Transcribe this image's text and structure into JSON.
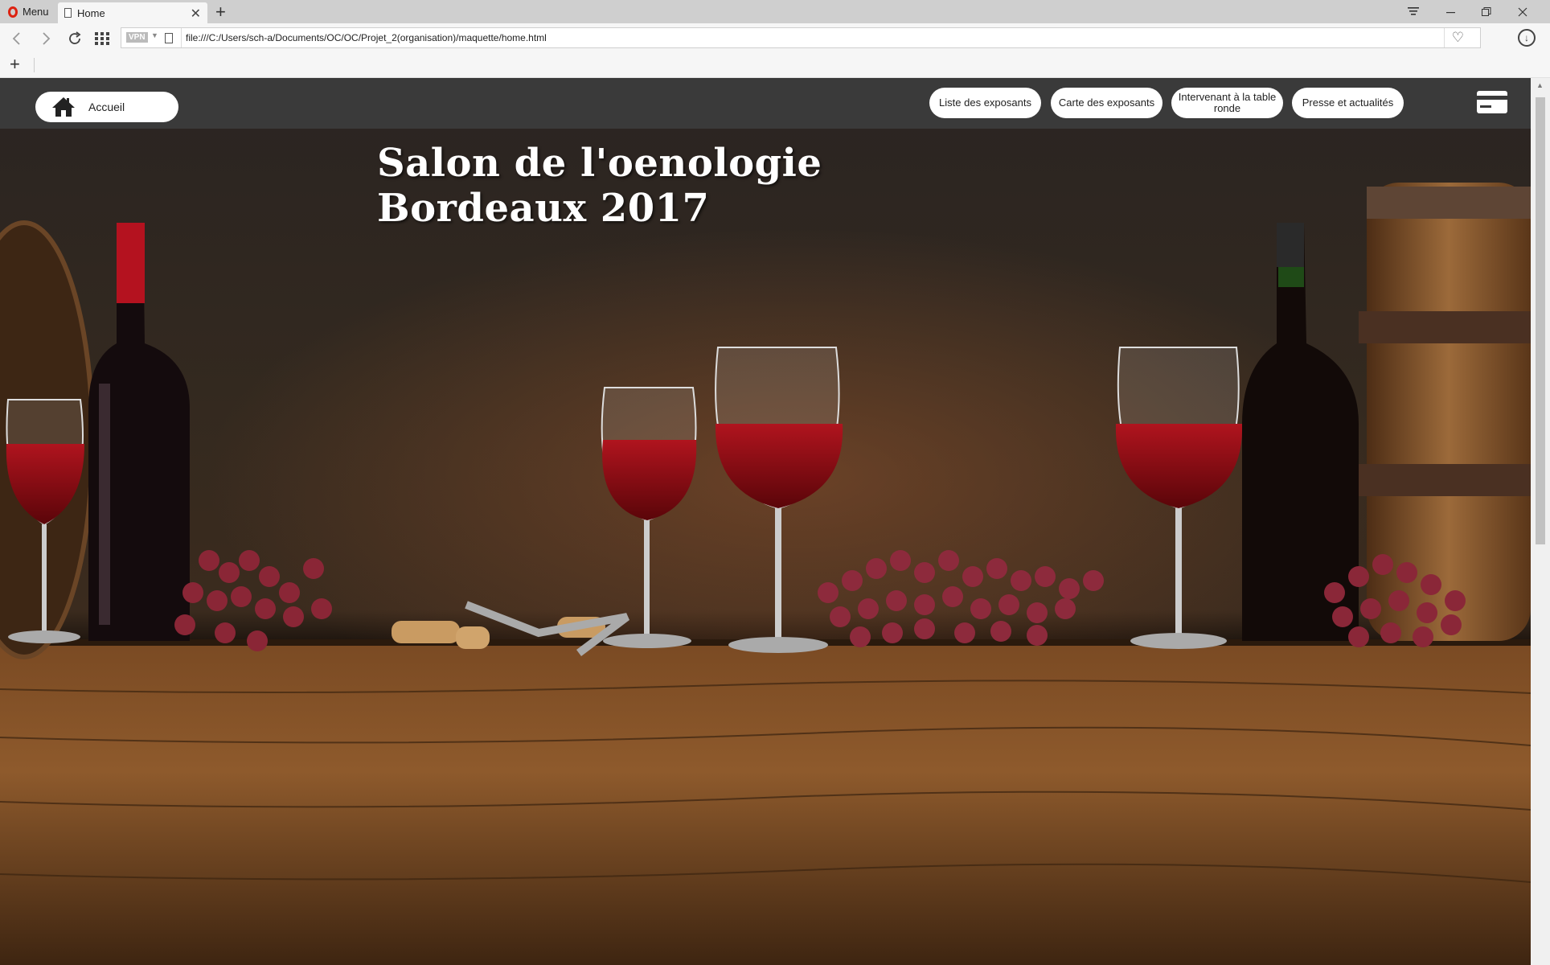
{
  "browser": {
    "menu_label": "Menu",
    "tab_title": "Home",
    "url": "file:///C:/Users/sch-a/Documents/OC/OC/Projet_2(organisation)/maquette/home.html",
    "vpn_label": "VPN"
  },
  "site": {
    "home_label": "Accueil",
    "nav": [
      {
        "label": "Liste des exposants"
      },
      {
        "label": "Carte des exposants"
      },
      {
        "label": "Intervenant à la table ronde"
      },
      {
        "label": "Presse et actualités"
      }
    ],
    "title_line1": "Salon de l'oenologie",
    "title_line2": "Bordeaux 2017"
  },
  "colors": {
    "opera_red": "#dd1111",
    "nav_bar": "#3a3a3a",
    "wine_red": "#8e0f16"
  },
  "icons": [
    "opera-logo-icon",
    "document-icon",
    "close-icon",
    "plus-icon",
    "tabs-menu-icon",
    "minimize-icon",
    "restore-icon",
    "back-icon",
    "forward-icon",
    "reload-icon",
    "speed-dial-icon",
    "heart-icon",
    "download-icon",
    "home-icon",
    "credit-card-icon"
  ]
}
